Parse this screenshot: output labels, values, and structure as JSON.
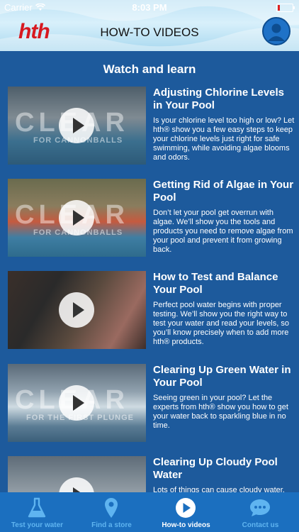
{
  "status": {
    "carrier": "Carrier",
    "time": "8:03 PM"
  },
  "header": {
    "logo": "hth",
    "title": "HOW-TO VIDEOS"
  },
  "section_title": "Watch and learn",
  "videos": [
    {
      "title": "Adjusting Chlorine Levels in Your Pool",
      "description": "Is your chlorine level too high or low? Let hth® show you a few easy steps to keep your chlorine levels just right for safe swimming, while avoiding algae blooms and odors.",
      "overlay_main": "CLEAR",
      "overlay_sub": "FOR CANNONBALLS"
    },
    {
      "title": "Getting Rid of Algae in Your Pool",
      "description": "Don’t let your pool get overrun with algae. We’ll show you the tools and products you need to remove algae from your pool and prevent it from growing back.",
      "overlay_main": "CLEAR",
      "overlay_sub": "FOR CANNONBALLS"
    },
    {
      "title": "How to Test and Balance Your Pool",
      "description": "Perfect pool water begins with proper testing. We’ll show you the right way to test your water and read your levels, so you’ll know precisely when to add more hth® products.",
      "overlay_main": "",
      "overlay_sub": ""
    },
    {
      "title": "Clearing Up Green Water in Your Pool",
      "description": "Seeing green in your pool? Let the experts from hth® show you how to get your water back to sparkling blue in no time.",
      "overlay_main": "CLEAR",
      "overlay_sub": "FOR THE FIRST PLUNGE"
    },
    {
      "title": "Clearing Up Cloudy Pool Water",
      "description": "Lots of things can cause cloudy water.",
      "overlay_main": "",
      "overlay_sub": ""
    }
  ],
  "tabs": [
    {
      "label": "Test your water",
      "icon": "flask-icon"
    },
    {
      "label": "Find a store",
      "icon": "location-pin-icon"
    },
    {
      "label": "How-to videos",
      "icon": "play-icon",
      "active": true
    },
    {
      "label": "Contact us",
      "icon": "chat-bubble-icon"
    }
  ],
  "colors": {
    "background": "#1d5a9c",
    "tabbar": "#1b6fbf",
    "brand_red": "#d71920",
    "tab_inactive": "#5fb4f0"
  }
}
